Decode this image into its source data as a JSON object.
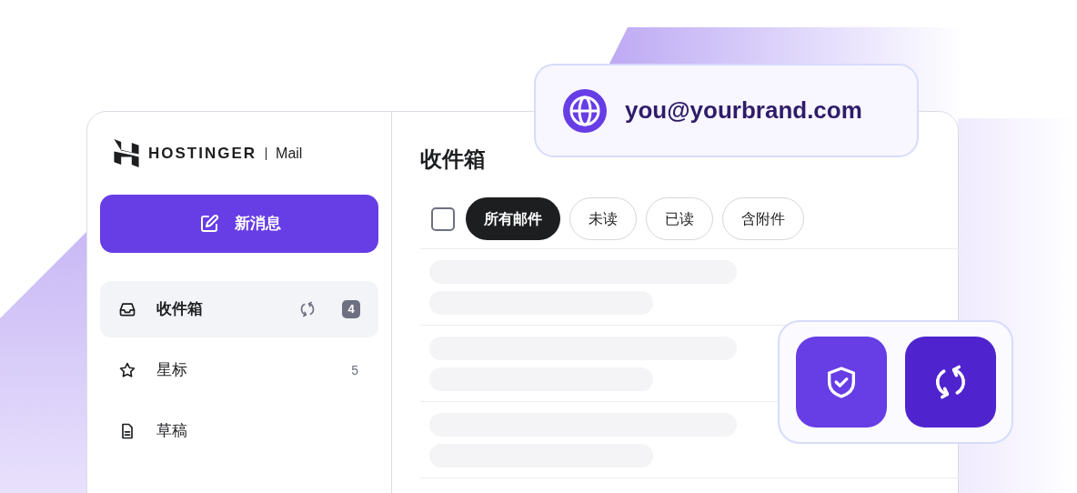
{
  "brand": {
    "name": "HOSTINGER",
    "product": "Mail"
  },
  "compose_button": {
    "label": "新消息"
  },
  "folders": [
    {
      "kind": "inbox",
      "label": "收件箱",
      "selected": true,
      "count": "4",
      "syncing": true
    },
    {
      "kind": "starred",
      "label": "星标",
      "selected": false,
      "count": "5",
      "syncing": false
    },
    {
      "kind": "drafts",
      "label": "草稿",
      "selected": false,
      "syncing": false
    }
  ],
  "mailbox": {
    "title": "收件箱",
    "select_all": {
      "checked": false
    },
    "filters": [
      {
        "label": "所有邮件",
        "selected": true
      },
      {
        "label": "未读",
        "selected": false
      },
      {
        "label": "已读",
        "selected": false
      },
      {
        "label": "含附件",
        "selected": false
      }
    ],
    "messages": [
      {
        "kind": "skeleton"
      },
      {
        "kind": "skeleton"
      },
      {
        "kind": "skeleton"
      }
    ]
  },
  "address_card": {
    "email": "you@yourbrand.com"
  },
  "feature_tiles": [
    {
      "kind": "security"
    },
    {
      "kind": "sync"
    }
  ]
}
